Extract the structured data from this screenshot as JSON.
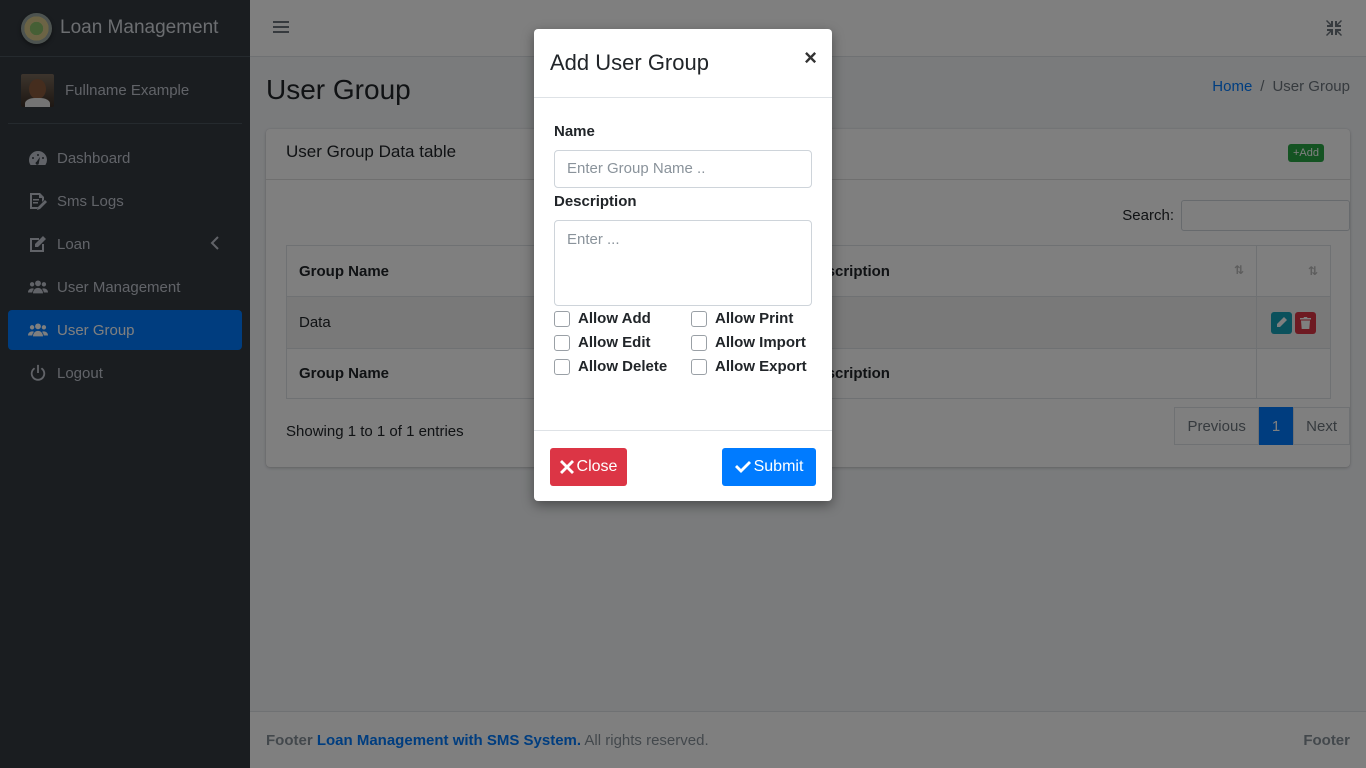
{
  "brand": {
    "title": "Loan Management"
  },
  "user": {
    "name": "Fullname Example"
  },
  "sidebar": {
    "items": [
      {
        "label": "Dashboard",
        "icon": "dashboard-icon"
      },
      {
        "label": "Sms Logs",
        "icon": "sms-logs-icon"
      },
      {
        "label": "Loan",
        "icon": "edit-icon"
      },
      {
        "label": "User Management",
        "icon": "users-icon"
      },
      {
        "label": "User Group",
        "icon": "users-icon",
        "active": true
      },
      {
        "label": "Logout",
        "icon": "power-icon"
      }
    ]
  },
  "page": {
    "title": "User Group",
    "breadcrumb_home": "Home",
    "breadcrumb_sep": "/",
    "breadcrumb_current": "User Group"
  },
  "card": {
    "title": "User Group Data table",
    "add_label": "Add",
    "search_label": "Search:"
  },
  "table": {
    "columns": [
      "Group Name",
      "Description"
    ],
    "rows": [
      [
        "Data",
        ""
      ]
    ]
  },
  "pagination": {
    "info": "Showing 1 to 1 of 1 entries",
    "previous": "Previous",
    "page": "1",
    "next": "Next"
  },
  "footer": {
    "prefix": "Footer",
    "link": "Loan Management with SMS System.",
    "suffix": "All rights reserved.",
    "right": "Footer"
  },
  "modal": {
    "title": "Add User Group",
    "close_x": "×",
    "name_label": "Name",
    "name_placeholder": "Enter Group Name ..",
    "desc_label": "Description",
    "desc_placeholder": "Enter ...",
    "checkboxes": [
      "Allow Add",
      "Allow Print",
      "Allow Edit",
      "Allow Import",
      "Allow Delete",
      "Allow Export"
    ],
    "close_label": "Close",
    "submit_label": "Submit"
  },
  "colors": {
    "sidebar": "#343a40",
    "primary": "#007bff",
    "danger": "#dc3545",
    "success": "#28a745",
    "info": "#17a2b8"
  }
}
